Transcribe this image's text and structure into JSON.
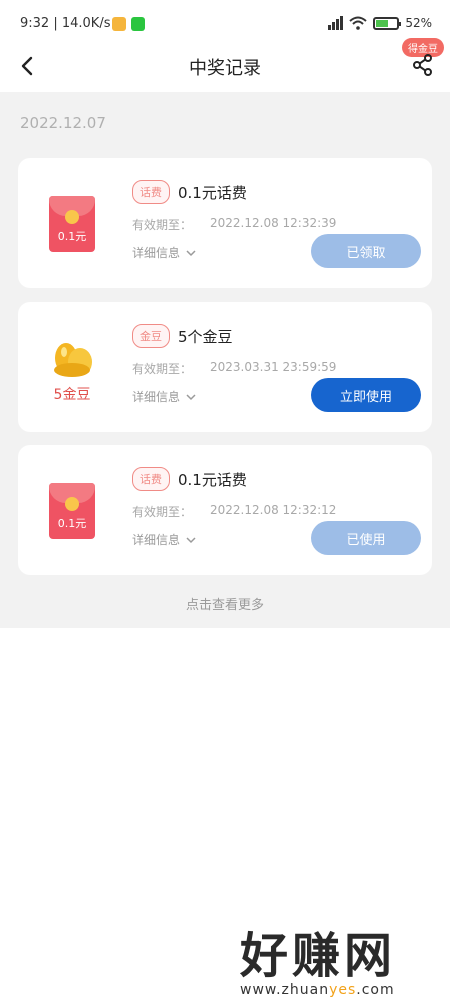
{
  "status": {
    "time": "9:32",
    "speed": "14.0K/s",
    "battery": "52%"
  },
  "nav": {
    "title": "中奖记录",
    "badge": "得金豆"
  },
  "date_header": "2022.12.07",
  "records": [
    {
      "tag": "话费",
      "name": "0.1元话费",
      "exp_label": "有效期至：",
      "exp_date": "2022.12.08 12:32:39",
      "detail": "详细信息",
      "button": "已领取",
      "icon_text": "0.1元"
    },
    {
      "tag": "金豆",
      "name": "5个金豆",
      "exp_label": "有效期至：",
      "exp_date": "2023.03.31 23:59:59",
      "detail": "详细信息",
      "button": "立即使用",
      "icon_text": "5金豆"
    },
    {
      "tag": "话费",
      "name": "0.1元话费",
      "exp_label": "有效期至：",
      "exp_date": "2022.12.08 12:32:12",
      "detail": "详细信息",
      "button": "已使用",
      "icon_text": "0.1元"
    }
  ],
  "more": "点击查看更多",
  "watermark": {
    "big": "好赚网",
    "small_pre": "www.zhuan",
    "small_hl": "yes",
    "small_post": ".com"
  },
  "colors": {
    "accent": "#1765cf",
    "disabled": "#9dbde7",
    "tag": "#f08b86",
    "background": "#f2f2f2"
  }
}
